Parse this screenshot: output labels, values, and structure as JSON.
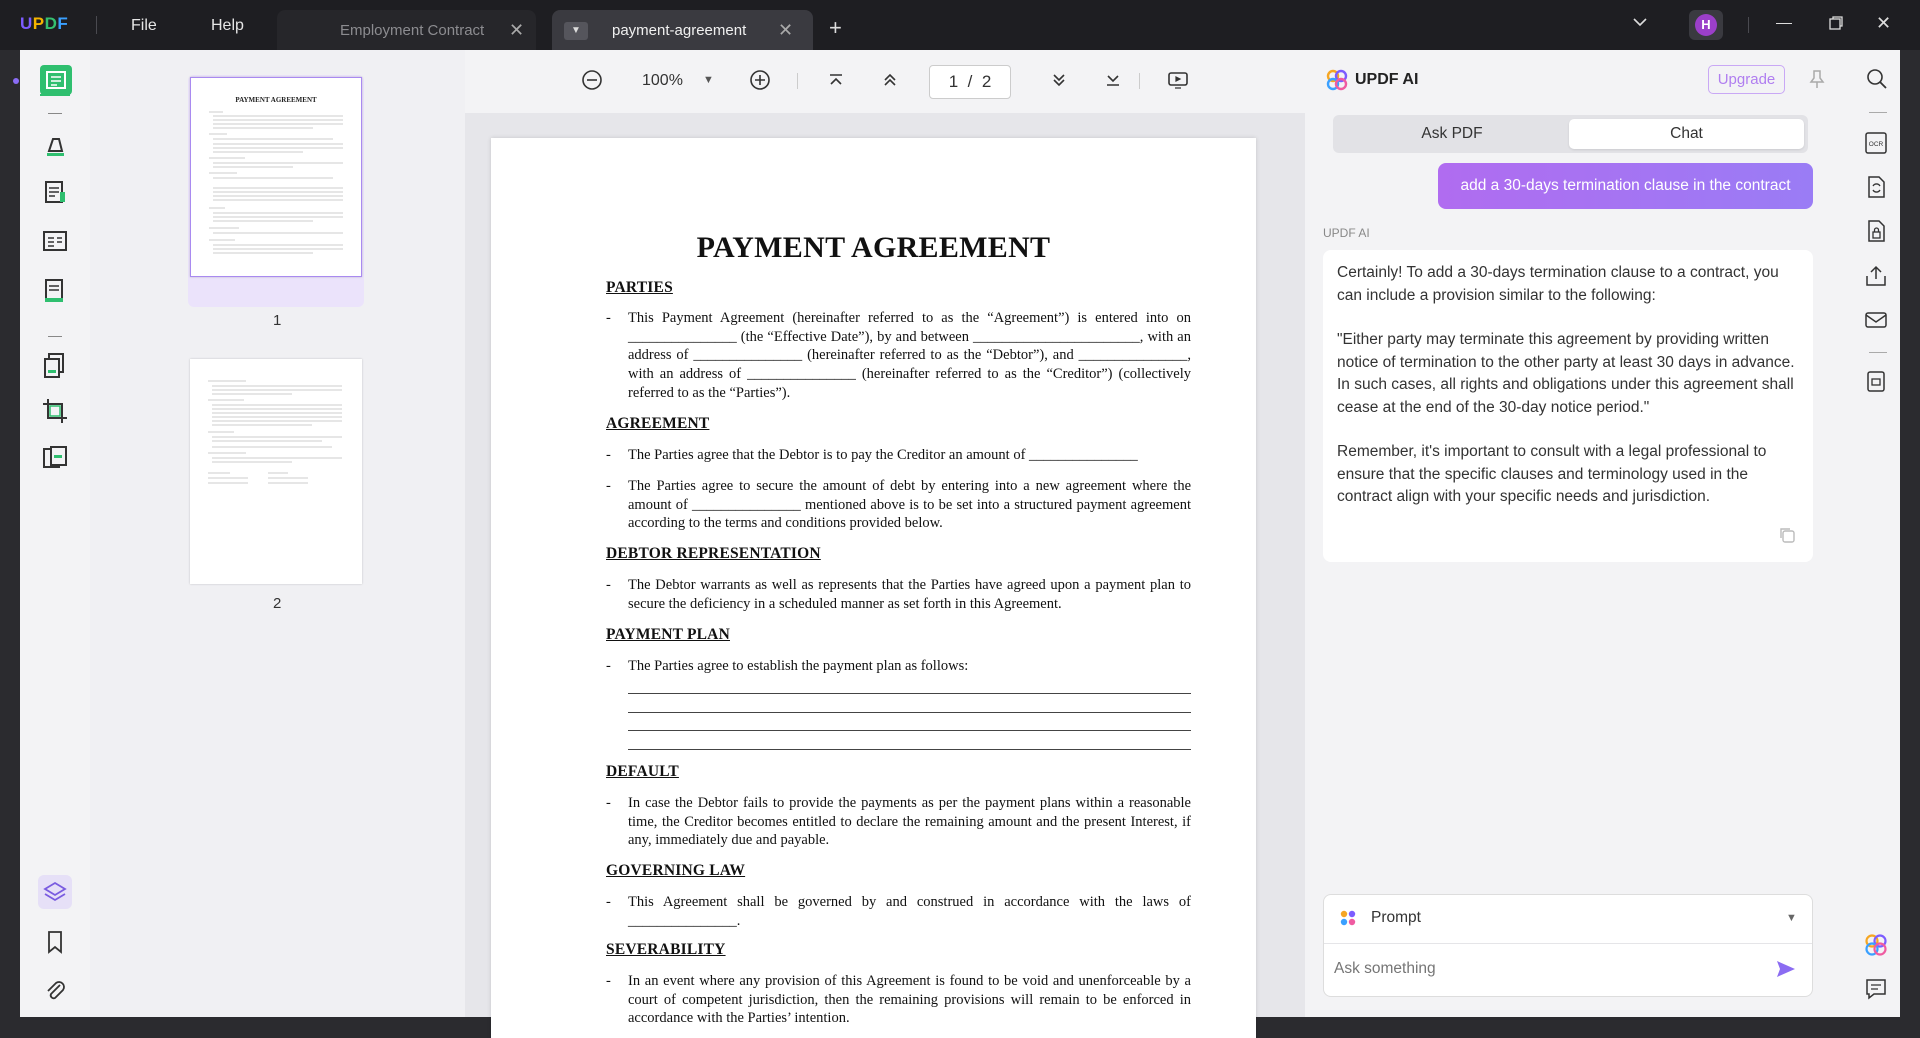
{
  "app": {
    "logo": "UPDF",
    "menu": [
      "File",
      "Help"
    ],
    "tabs": [
      {
        "label": "Employment Contract",
        "active": false
      },
      {
        "label": "payment-agreement",
        "active": true
      }
    ],
    "user_initial": "H"
  },
  "thumbnails": {
    "pages": [
      "1",
      "2"
    ]
  },
  "viewer": {
    "zoom": "100%",
    "current_page": "1",
    "separator": "/",
    "total_pages": "2"
  },
  "document": {
    "title": "PAYMENT AGREEMENT",
    "sections": [
      {
        "heading": "PARTIES",
        "paras": [
          "This Payment Agreement (hereinafter referred to as the “Agreement”) is entered into on _______________ (the “Effective Date”), by and between _______________________, with an address of _______________ (hereinafter referred to as the “Debtor”), and _______________, with an address of _______________ (hereinafter referred to as the “Creditor”) (collectively referred to as the “Parties”)."
        ]
      },
      {
        "heading": "AGREEMENT",
        "paras": [
          "The Parties agree that the Debtor is to pay the Creditor an amount of _______________",
          "The Parties agree to secure the amount of debt by entering into a new agreement where the amount of _______________ mentioned above is to be set into a structured payment agreement according to the terms and conditions provided below."
        ]
      },
      {
        "heading": "DEBTOR REPRESENTATION",
        "paras": [
          "The Debtor warrants as well as represents that the Parties have agreed upon a payment plan to secure the deficiency in a scheduled manner as set forth in this Agreement."
        ]
      },
      {
        "heading": "PAYMENT PLAN",
        "paras": [
          "The Parties agree to establish the payment plan as follows:"
        ]
      },
      {
        "heading": "DEFAULT",
        "paras": [
          "In case the Debtor fails to provide the payments as per the payment plans within a reasonable time, the Creditor becomes entitled to declare the remaining amount and the present Interest, if any, immediately due and payable."
        ]
      },
      {
        "heading": "GOVERNING LAW",
        "paras": [
          "This Agreement shall be governed by and construed in accordance with the laws of _______________."
        ]
      },
      {
        "heading": "SEVERABILITY",
        "paras": [
          "In an event where any provision of this Agreement is found to be void and unenforceable by a court of competent jurisdiction, then the remaining provisions will remain to be enforced in accordance with the Parties’ intention."
        ]
      }
    ]
  },
  "ai": {
    "title": "UPDF AI",
    "upgrade_label": "Upgrade",
    "tabs": [
      "Ask PDF",
      "Chat"
    ],
    "user_message": "add a 30-days termination clause in the contract",
    "sender_label": "UPDF AI",
    "answer": [
      "Certainly! To add a 30-days termination clause to a contract, you can include a provision similar to the following:",
      "\"Either party may terminate this agreement by providing written notice of termination to the other party at least 30 days in advance. In such cases, all rights and obligations under this agreement shall cease at the end of the 30-day notice period.\"",
      "Remember, it's important to consult with a legal professional to ensure that the specific clauses and terminology used in the contract align with your specific needs and jurisdiction."
    ],
    "prompt_label": "Prompt",
    "input_placeholder": "Ask something"
  },
  "colors": {
    "accent": "#9b6cf0",
    "brand_purple": "#7c5cff",
    "titlebar": "#1e1e22"
  }
}
